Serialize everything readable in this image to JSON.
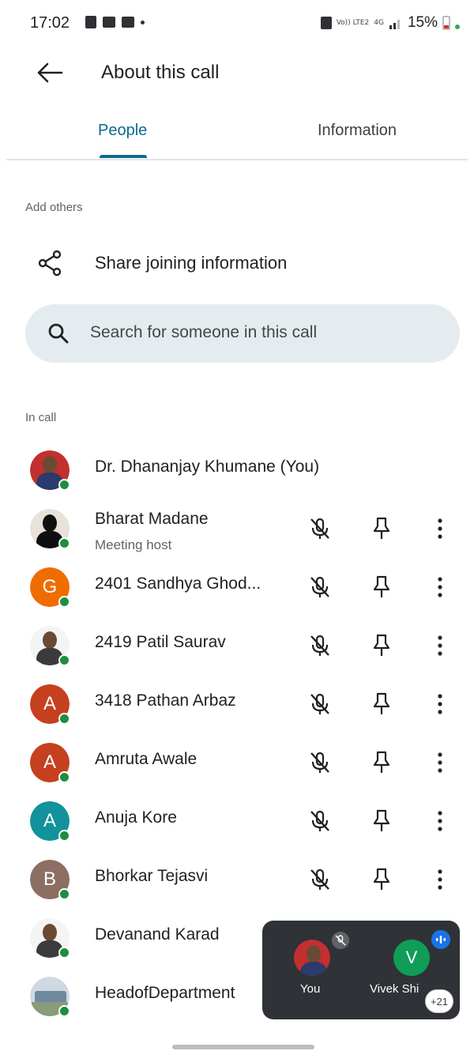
{
  "status_bar": {
    "time": "17:02",
    "network_label": "Vo)) LTE2",
    "network_type": "4G",
    "battery_percent": "15%",
    "colors": {
      "battery_low": "#d93025",
      "charging": "#34a853"
    }
  },
  "app_bar": {
    "title": "About this call",
    "back_icon": "arrow-left-icon"
  },
  "tabs": [
    {
      "label": "People",
      "selected": true
    },
    {
      "label": "Information",
      "selected": false
    }
  ],
  "add_others": {
    "section_label": "Add others",
    "share_label": "Share joining information",
    "share_icon": "share-icon"
  },
  "search": {
    "placeholder": "Search for someone in this call",
    "icon": "search-icon"
  },
  "in_call": {
    "section_label": "In call",
    "people": [
      {
        "name": "Dr. Dhananjay Khumane (You)",
        "subtitle": "",
        "avatar_type": "photo",
        "is_self": true
      },
      {
        "name": "Bharat Madane",
        "subtitle": "Meeting host",
        "avatar_type": "photo",
        "is_self": false
      },
      {
        "name": "2401 Sandhya Ghod...",
        "subtitle": "",
        "avatar_type": "letter",
        "letter": "G",
        "color": "#ef6c00",
        "is_self": false
      },
      {
        "name": "2419 Patil Saurav",
        "subtitle": "",
        "avatar_type": "photo",
        "is_self": false
      },
      {
        "name": "3418 Pathan Arbaz",
        "subtitle": "",
        "avatar_type": "letter",
        "letter": "A",
        "color": "#c5401f",
        "is_self": false
      },
      {
        "name": "Amruta Awale",
        "subtitle": "",
        "avatar_type": "letter",
        "letter": "A",
        "color": "#c5401f",
        "is_self": false
      },
      {
        "name": "Anuja Kore",
        "subtitle": "",
        "avatar_type": "letter",
        "letter": "A",
        "color": "#12929a",
        "is_self": false
      },
      {
        "name": "Bhorkar Tejasvi",
        "subtitle": "",
        "avatar_type": "letter",
        "letter": "B",
        "color": "#8d6e63",
        "is_self": false
      },
      {
        "name": "Devanand Karad",
        "subtitle": "",
        "avatar_type": "photo",
        "is_self": false
      },
      {
        "name": "HeadofDepartment",
        "subtitle": "",
        "avatar_type": "photo",
        "is_self": false
      }
    ],
    "row_icons": [
      "mic-off-icon",
      "pin-icon",
      "more-vert-icon"
    ]
  },
  "pip": {
    "you_label": "You",
    "other_letter": "V",
    "other_label": "Vivek Shi",
    "more_count": "+21",
    "colors": {
      "background": "#2f3236",
      "other_avatar": "#0f9d58",
      "speaking": "#1a73e8"
    }
  },
  "colors": {
    "accent": "#0b6a8f",
    "search_bg": "#e4ecf0",
    "online": "#1e8e3e"
  }
}
